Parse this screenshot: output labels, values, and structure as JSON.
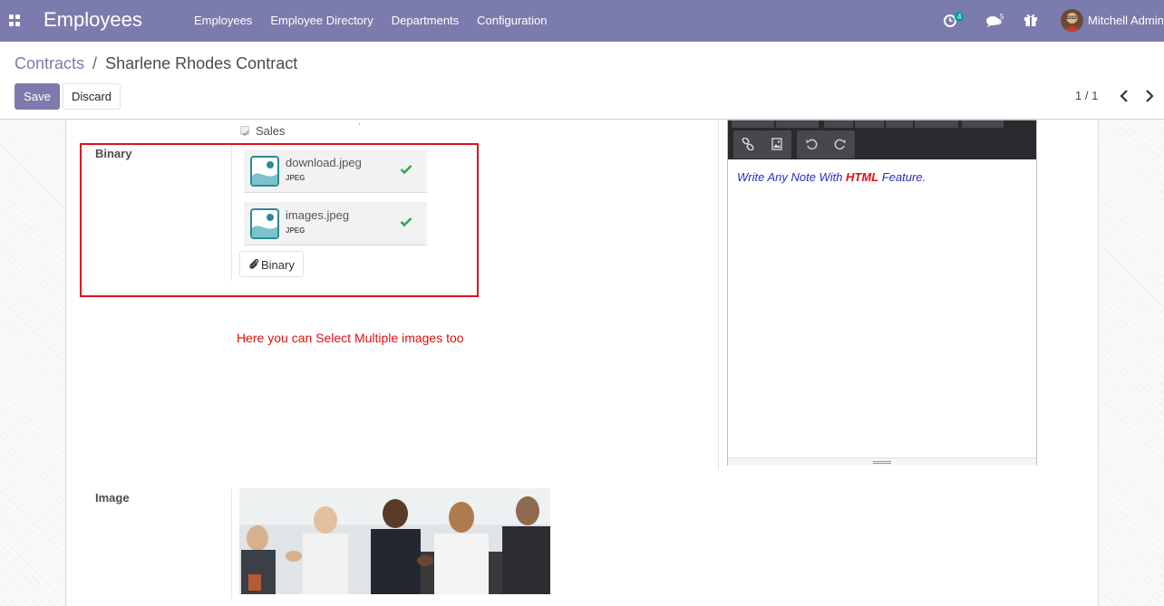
{
  "navbar": {
    "app_title": "Employees",
    "menu": [
      "Employees",
      "Employee Directory",
      "Departments",
      "Configuration"
    ],
    "activity_count": "4",
    "message_count": "5",
    "user_name": "Mitchell Admin"
  },
  "breadcrumb": {
    "parent": "Contracts",
    "separator": "/",
    "current": "Sharlene Rhodes Contract"
  },
  "actions": {
    "save_label": "Save",
    "discard_label": "Discard"
  },
  "pager": {
    "value": "1 / 1"
  },
  "form": {
    "sales_checkbox_label": "Sales",
    "binary": {
      "label": "Binary",
      "attachments": [
        {
          "name": "download.jpeg",
          "type": "JPEG"
        },
        {
          "name": "images.jpeg",
          "type": "JPEG"
        }
      ],
      "button_label": "Binary"
    },
    "annotation": "Here you can Select Multiple images too",
    "editor_note": {
      "before": "Write Any Note With ",
      "highlight": "HTML",
      "after": " Feature."
    },
    "image_label": "Image"
  },
  "colors": {
    "brand": "#7c7bad",
    "annotation_red": "#e0101c",
    "success_green": "#28a745",
    "teal": "#00a09d"
  }
}
